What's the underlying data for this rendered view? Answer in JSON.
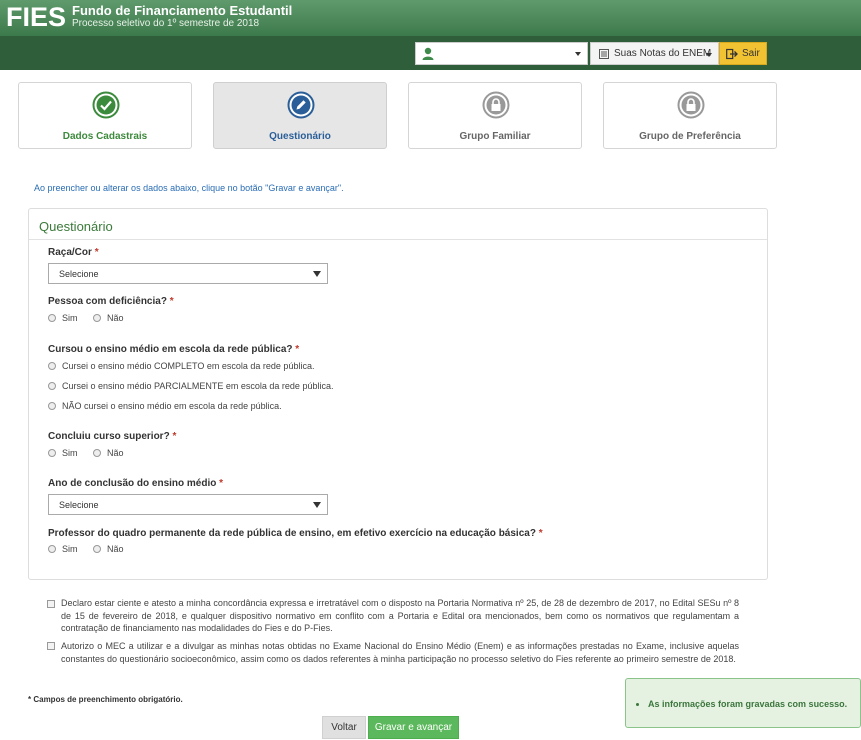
{
  "header": {
    "logo": "FIES",
    "title": "Fundo de Financiamento Estudantil",
    "subtitle": "Processo seletivo do 1º semestre de 2018"
  },
  "navbar": {
    "user_value": "",
    "notas_label": "Suas Notas do ENEM",
    "sair_label": "Sair"
  },
  "steps": [
    {
      "label": "Dados Cadastrais",
      "state": "done",
      "icon": "check-icon"
    },
    {
      "label": "Questionário",
      "state": "active",
      "icon": "pencil-icon"
    },
    {
      "label": "Grupo Familiar",
      "state": "locked",
      "icon": "lock-icon"
    },
    {
      "label": "Grupo de Preferência",
      "state": "locked",
      "icon": "lock-icon"
    }
  ],
  "info_text": "Ao preencher ou alterar os dados abaixo, clique no botão \"Gravar e avançar\".",
  "panel": {
    "title": "Questionário",
    "questions": {
      "raca": {
        "label": "Raça/Cor",
        "value": "Selecione"
      },
      "deficiencia": {
        "label": "Pessoa com deficiência?",
        "options": [
          "Sim",
          "Não"
        ]
      },
      "ensino_medio": {
        "label": "Cursou o ensino médio em escola da rede pública?",
        "options": [
          "Cursei o ensino médio COMPLETO em escola da rede pública.",
          "Cursei o ensino médio PARCIALMENTE em escola da rede pública.",
          "NÃO cursei o ensino médio em escola da rede pública."
        ]
      },
      "superior": {
        "label": "Concluiu curso superior?",
        "options": [
          "Sim",
          "Não"
        ]
      },
      "ano_conclusao": {
        "label": "Ano de conclusão do ensino médio",
        "value": "Selecione"
      },
      "professor": {
        "label": "Professor do quadro permanente da rede pública de ensino, em efetivo exercício na educação básica?",
        "options": [
          "Sim",
          "Não"
        ]
      }
    },
    "required_mark": "*"
  },
  "declarations": [
    "Declaro estar ciente e atesto a minha concordância expressa e irretratável com o disposto na Portaria Normativa nº 25, de 28 de dezembro de 2017, no Edital SESu nº 8 de 15 de fevereiro de 2018, e qualquer dispositivo normativo em conflito com a Portaria e Edital ora mencionados, bem como os normativos que regulamentam a contratação de financiamento nas modalidades do Fies e do P-Fies.",
    "Autorizo o MEC a utilizar e a divulgar as minhas notas obtidas no Exame Nacional do Ensino Médio (Enem) e as informações prestadas no Exame, inclusive aquelas constantes do questionário socioeconômico, assim como os dados referentes à minha participação no processo seletivo do Fies referente ao primeiro semestre de 2018."
  ],
  "required_note": "* Campos de preenchimento obrigatório.",
  "buttons": {
    "voltar": "Voltar",
    "gravar": "Gravar e avançar"
  },
  "toast": "As informações foram gravadas com sucesso.",
  "colors": {
    "header_green": "#4f8a5c",
    "nav_dark_green": "#2f5e3b",
    "accent_green": "#5cb85c",
    "link_blue": "#2a6db5",
    "sair_yellow": "#f1c232"
  }
}
